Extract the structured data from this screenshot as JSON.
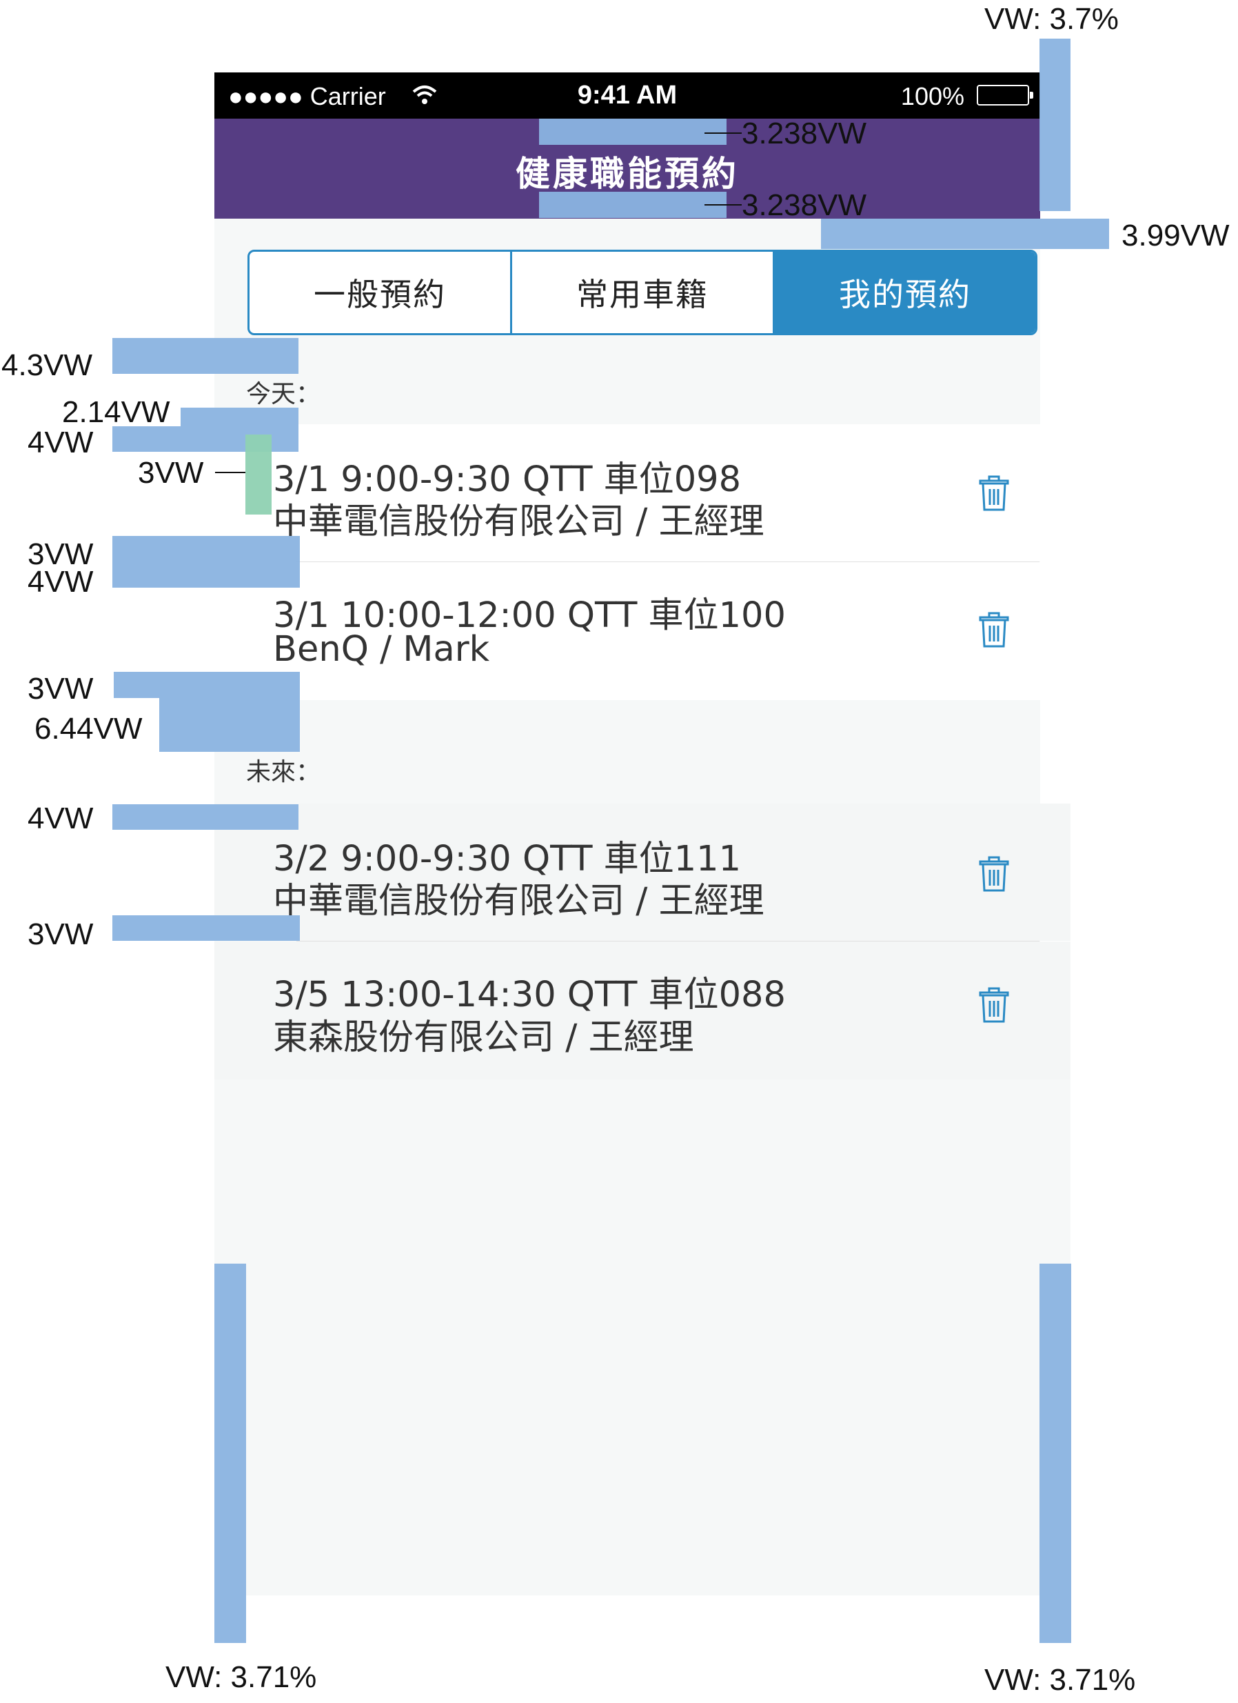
{
  "status_bar": {
    "carrier": "●●●●● Carrier",
    "time": "9:41 AM",
    "battery": "100%"
  },
  "header": {
    "title": "健康職能預約"
  },
  "tabs": [
    {
      "label": "一般預約",
      "active": false
    },
    {
      "label": "常用車籍",
      "active": false
    },
    {
      "label": "我的預約",
      "active": true
    }
  ],
  "sections": {
    "today_label": "今天：",
    "future_label": "未來："
  },
  "today": [
    {
      "line1": "3/1  9:00-9:30  QTT 車位098",
      "line2": "中華電信股份有限公司 / 王經理"
    },
    {
      "line1": "3/1 10:00-12:00  QTT 車位100",
      "line2": "BenQ / Mark"
    }
  ],
  "future": [
    {
      "line1": "3/2  9:00-9:30  QTT 車位111",
      "line2": "中華電信股份有限公司 / 王經理"
    },
    {
      "line1": "3/5  13:00-14:30  QTT 車位088",
      "line2": "東森股份有限公司 / 王經理"
    }
  ],
  "annotations": {
    "vw_top": "VW: 3.7%",
    "header_top": "3.238VW",
    "header_bottom": "3.238VW",
    "seg_gap": "3.99VW",
    "a43": "4.3VW",
    "a214": "2.14VW",
    "a4_1": "4VW",
    "a3_teal": "3VW",
    "a3_1": "3VW",
    "a4_2": "4VW",
    "a3_2": "3VW",
    "a644": "6.44VW",
    "a4_3": "4VW",
    "a3_3": "3VW",
    "vw_left": "VW: 3.71%",
    "vw_right": "VW: 3.71%"
  },
  "colors": {
    "header": "#563d83",
    "accent": "#2a8ac4",
    "spec_bar": "#8ab3e0"
  },
  "icons": {
    "delete": "trash-icon",
    "wifi": "wifi-icon",
    "battery": "battery-icon"
  }
}
